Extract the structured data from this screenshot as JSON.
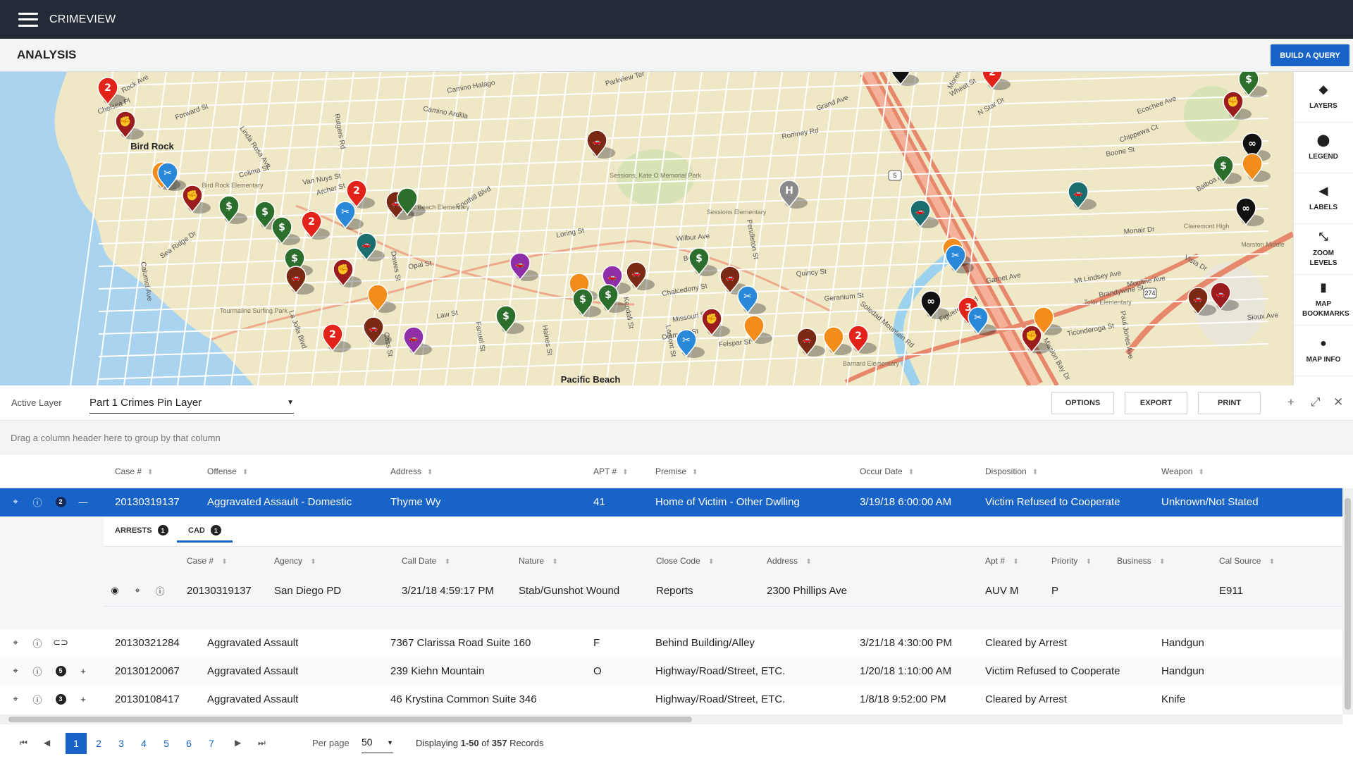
{
  "app": {
    "title": "CRIMEVIEW"
  },
  "header": {
    "page_title": "ANALYSIS",
    "build_query_label": "BUILD A QUERY"
  },
  "map": {
    "labels": [
      "Bird Rock",
      "Pacific Beach",
      "Sessions, Kate O Memorial Park",
      "Pacific Beach Elementary",
      "Sessions Elementary",
      "Tourmaline Surfing Park",
      "Bird Rock Elementary",
      "Clairemont High",
      "Marston Middle",
      "Tolor Elementary",
      "Barnard Elementary"
    ],
    "streets": [
      "Rock Ave",
      "Forward St",
      "Chelsea Pl",
      "Linda Rosa Ave",
      "Camino Halago",
      "Camino Ardilla",
      "Rutgers Rd",
      "Parkview Ter",
      "Morena Blvd",
      "Wheat St",
      "N Star Dr",
      "Ecochee Ave",
      "Chippewa Ct",
      "Boone St",
      "Colima St",
      "Van Nuys St",
      "Archer St",
      "Foothill Blvd",
      "Loring St",
      "Wilbur Ave",
      "Beryl St",
      "Opal St",
      "Felspar St",
      "Diamond St",
      "Garnet Ave",
      "Balboa Ave",
      "Soledad Mountain Rd",
      "Quincy St",
      "Geranium St",
      "Romney Rd",
      "Pendleton St",
      "Missouri St",
      "Chalcedony St",
      "Sioux Ave",
      "Ticonderoga St",
      "Mt Lindsey Ave",
      "Moultrie Ave",
      "Brandywine St",
      "Sea Ridge Dr",
      "La Jolla Blvd",
      "Calumet Ave",
      "Cass St",
      "Fanuel St",
      "Haines St",
      "Lamont St",
      "Kendall St",
      "Dawes St",
      "Law St",
      "Grand Ave",
      "Mission Bay Dr",
      "Figueroa Blvd",
      "Monair Dr",
      "Vista Dr",
      "Paul Jones Ave"
    ],
    "highway_shields": [
      "5",
      "274"
    ],
    "pin_colors": {
      "red": "#e2231a",
      "darkred": "#9b1c1c",
      "green": "#2c6e2c",
      "teal": "#1a6e6e",
      "blue": "#2a88d8",
      "orange": "#f28c1a",
      "purple": "#8e2fa8",
      "black": "#111111",
      "brown": "#7a2a14",
      "gray": "#8a8a8a"
    }
  },
  "side_tools": [
    {
      "icon": "layers-icon",
      "label": "LAYERS"
    },
    {
      "icon": "map-pin-icon",
      "label": "LEGEND"
    },
    {
      "icon": "tag-icon",
      "label": "LABELS"
    },
    {
      "icon": "expand-icon",
      "label": "ZOOM LEVELS"
    },
    {
      "icon": "book-icon",
      "label": "MAP BOOKMARKS"
    },
    {
      "icon": "info-icon",
      "label": "MAP INFO"
    }
  ],
  "layer_bar": {
    "active_layer_label": "Active Layer",
    "active_layer_value": "Part 1 Crimes Pin Layer",
    "options_label": "OPTIONS",
    "export_label": "EXPORT",
    "print_label": "PRINT"
  },
  "group_hint": "Drag a column header here to group by that column",
  "table": {
    "columns": [
      "Case #",
      "Offense",
      "Address",
      "APT #",
      "Premise",
      "Occur Date",
      "Disposition",
      "Weapon"
    ],
    "selected_row": {
      "badge": "2",
      "case": "20130319137",
      "offense": "Aggravated Assault - Domestic",
      "address": "Thyme Wy",
      "apt": "41",
      "premise": "Home of Victim - Other Dwlling",
      "occur": "3/19/18 6:00:00 AM",
      "disposition": "Victim Refused to Cooperate",
      "weapon": "Unknown/Not Stated"
    },
    "rows": [
      {
        "badge": "",
        "case": "20130321284",
        "offense": "Aggravated Assault",
        "address": "7367 Clarissa Road Suite 160",
        "apt": "F",
        "premise": "Behind Building/Alley",
        "occur": "3/21/18 4:30:00 PM",
        "disposition": "Cleared by Arrest",
        "weapon": "Handgun"
      },
      {
        "badge": "5",
        "case": "20130120067",
        "offense": "Aggravated Assault",
        "address": "239 Kiehn Mountain",
        "apt": "O",
        "premise": "Highway/Road/Street, ETC.",
        "occur": "1/20/18 1:10:00 AM",
        "disposition": "Victim Refused to Cooperate",
        "weapon": "Handgun"
      },
      {
        "badge": "3",
        "case": "20130108417",
        "offense": "Aggravated Assault",
        "address": "46 Krystina Common Suite 346",
        "apt": "",
        "premise": "Highway/Road/Street, ETC.",
        "occur": "1/8/18 9:52:00 PM",
        "disposition": "Cleared by Arrest",
        "weapon": "Knife"
      }
    ]
  },
  "detail": {
    "tabs": [
      {
        "label": "ARRESTS",
        "count": "1"
      },
      {
        "label": "CAD",
        "count": "1"
      }
    ],
    "columns": [
      "Case #",
      "Agency",
      "Call Date",
      "Nature",
      "Close Code",
      "Address",
      "Apt #",
      "Priority",
      "Business",
      "Cal Source"
    ],
    "row": {
      "case": "20130319137",
      "agency": "San Diego PD",
      "call_date": "3/21/18 4:59:17 PM",
      "nature": "Stab/Gunshot Wound",
      "close_code": "Reports",
      "address": "2300 Phillips Ave",
      "apt": "AUV M",
      "priority": "P",
      "business": "",
      "cal_source": "E911"
    }
  },
  "pager": {
    "pages": [
      "1",
      "2",
      "3",
      "4",
      "5",
      "6",
      "7"
    ],
    "current": "1",
    "per_page_label": "Per page",
    "per_page_value": "50",
    "display_prefix": "Displaying",
    "display_range": "1-50",
    "display_of": "of",
    "display_total": "357",
    "display_suffix": "Records"
  }
}
